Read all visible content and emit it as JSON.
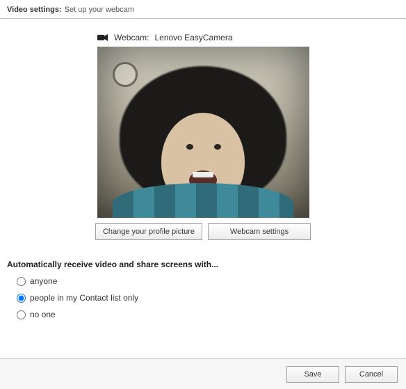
{
  "header": {
    "title_bold": "Video settings:",
    "title_rest": "Set up your webcam"
  },
  "webcam": {
    "label": "Webcam:",
    "name": "Lenovo EasyCamera"
  },
  "buttons": {
    "change_picture": "Change your profile picture",
    "webcam_settings": "Webcam settings"
  },
  "sharing": {
    "heading": "Automatically receive video and share screens with...",
    "options": [
      {
        "value": "anyone",
        "label": "anyone"
      },
      {
        "value": "contacts",
        "label": "people in my Contact list only"
      },
      {
        "value": "noone",
        "label": "no one"
      }
    ],
    "selected": "contacts"
  },
  "footer": {
    "save": "Save",
    "cancel": "Cancel"
  }
}
